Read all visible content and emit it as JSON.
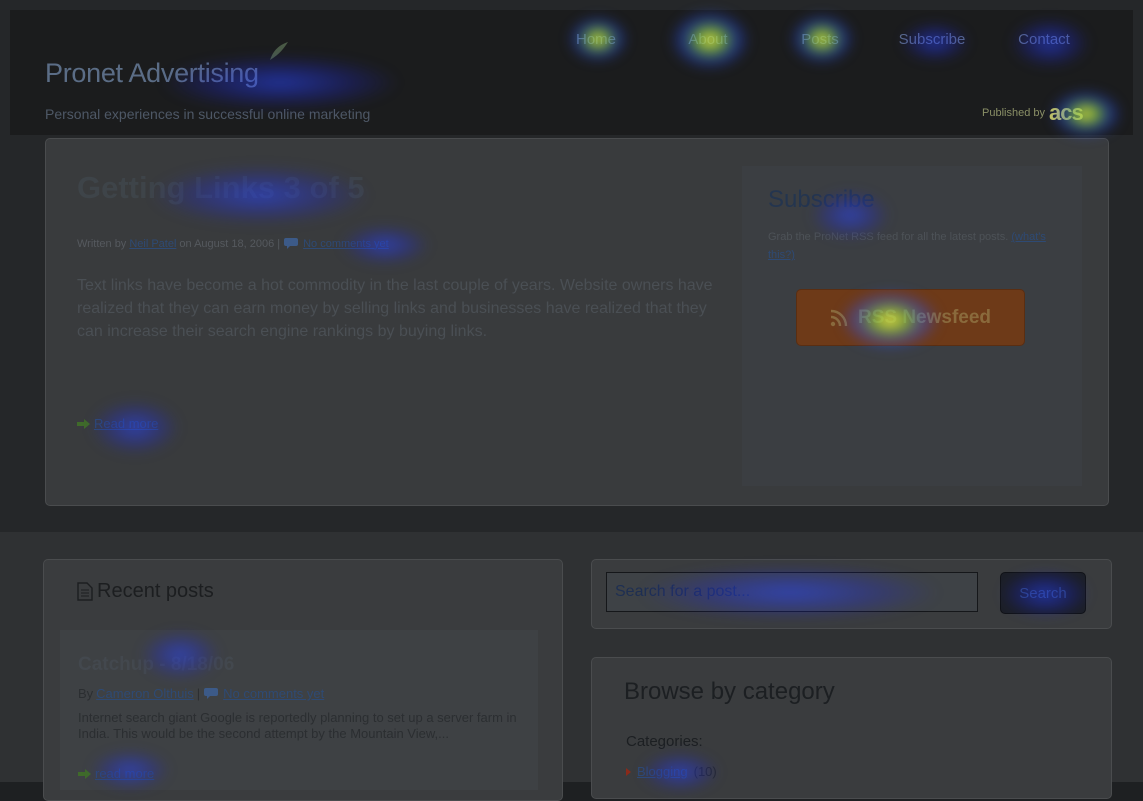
{
  "nav": {
    "items": [
      {
        "label": "Home"
      },
      {
        "label": "About"
      },
      {
        "label": "Posts"
      },
      {
        "label": "Subscribe"
      },
      {
        "label": "Contact"
      }
    ]
  },
  "brand": {
    "title": "Pronet Advertising",
    "tagline": "Personal experiences in successful online marketing",
    "published_by": "Published by",
    "publisher_logo": "acs"
  },
  "featured_post": {
    "title": "Getting Links 3 of 5",
    "meta_prefix": "Written by",
    "author": "Neil Patel",
    "date_text": "on August 18, 2006 |",
    "comments": "No comments yet",
    "excerpt": "Text links have become a hot commodity in the last couple of years. Website owners have realized that they can earn money by selling links and businesses have realized that they can increase their search engine rankings by buying links.",
    "read_more": "Read more"
  },
  "subscribe": {
    "title": "Subscribe",
    "text": "Grab the ProNet RSS feed for all the latest posts.",
    "help_link": "(what's this?)",
    "button_label": "RSS Newsfeed"
  },
  "recent_posts": {
    "title": "Recent posts",
    "items": [
      {
        "title": "Catchup - 8/18/06",
        "by": "By",
        "author": "Cameron Olthuis",
        "separator": "|",
        "comments": "No comments yet",
        "excerpt": "Internet search giant Google is reportedly planning to set up a server farm in India. This would be the second attempt by the Mountain View,...",
        "read_more": "read more"
      }
    ]
  },
  "search": {
    "placeholder": "Search for a post...",
    "button_label": "Search"
  },
  "categories": {
    "title": "Browse by category",
    "label": "Categories:",
    "items": [
      {
        "name": "Blogging",
        "count": "(10)"
      }
    ]
  },
  "colors": {
    "heat_hot": "#ffe850",
    "heat_cool": "#2846ff"
  }
}
